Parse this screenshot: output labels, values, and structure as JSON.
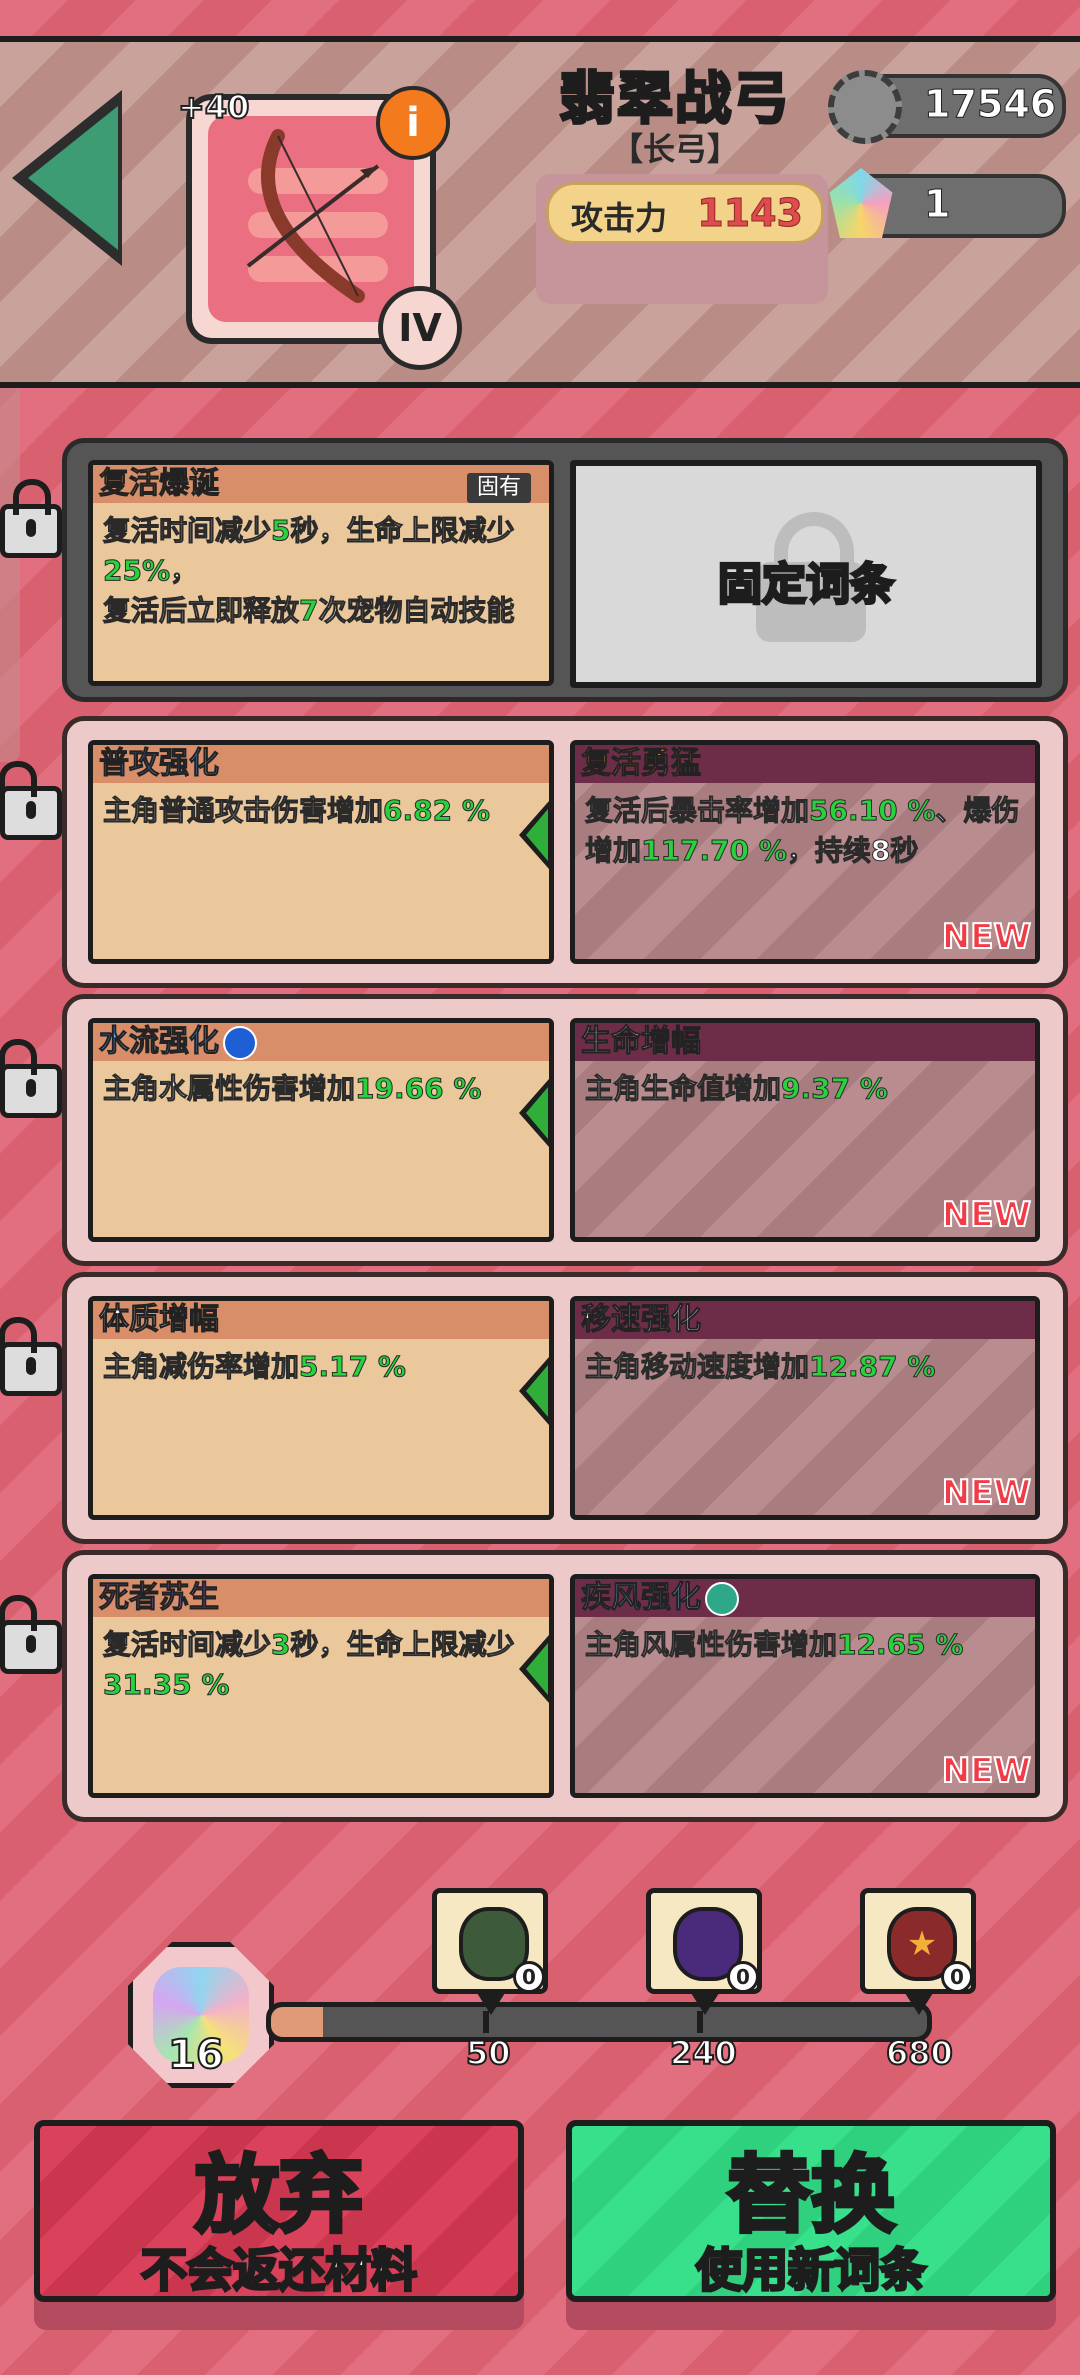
{
  "header": {
    "item_level": "+40",
    "info_icon": "i",
    "tier": "IV",
    "title": "翡翠战弓",
    "subtitle": "【长弓】",
    "attack_label": "攻击力",
    "attack_value": "1143",
    "gear_value": "17546",
    "crystal_value": "1"
  },
  "affix_rows": [
    {
      "locked": true,
      "old": {
        "name": "复活爆诞",
        "badge": "固有",
        "text_parts": [
          "复活时间减少",
          "5",
          "秒，生命上限减少",
          "25%",
          "，",
          "复活后立即释放",
          "7",
          "次宠物自动技能"
        ]
      },
      "fixed_label": "固定词条"
    },
    {
      "locked": false,
      "old": {
        "name": "普攻强化",
        "pre": "主角普通攻击伤害增加",
        "value": "6.82 %"
      },
      "new": {
        "name": "复活勇猛",
        "pre": "复活后暴击率增加",
        "value": "56.10 %",
        "mid": "、爆伤增加",
        "value2": "117.70 %",
        "post": "，持续8秒"
      },
      "new_tag": "NEW"
    },
    {
      "locked": false,
      "old": {
        "name": "水流强化",
        "pre": "主角水属性伤害增加",
        "value": "19.66 %"
      },
      "new": {
        "name": "生命增幅",
        "pre": "主角生命值增加",
        "value": "9.37 %"
      },
      "new_tag": "NEW"
    },
    {
      "locked": false,
      "old": {
        "name": "体质增幅",
        "pre": "主角减伤率增加",
        "value": "5.17 %"
      },
      "new": {
        "name": "移速强化",
        "pre": "主角移动速度增加",
        "value": "12.87 %"
      },
      "new_tag": "NEW"
    },
    {
      "locked": false,
      "old": {
        "name": "死者苏生",
        "pre": "复活时间减少",
        "v1": "3",
        "mid": "秒，生命上限减少",
        "value": "31.35 %"
      },
      "new": {
        "name": "疾风强化",
        "pre": "主角风属性伤害增加",
        "value": "12.65 %"
      },
      "new_tag": "NEW"
    }
  ],
  "materials": {
    "bag_count": "16",
    "progress_fraction": 0.08,
    "rewards": [
      {
        "threshold": "50",
        "count": "0",
        "color": "#3d5a3a"
      },
      {
        "threshold": "240",
        "count": "0",
        "color": "#4a2a7a"
      },
      {
        "threshold": "680",
        "count": "0",
        "color": "#8a2a2a"
      }
    ]
  },
  "buttons": {
    "abandon_main": "放弃",
    "abandon_sub": "不会返还材料",
    "replace_main": "替换",
    "replace_sub": "使用新词条"
  },
  "colors": {
    "highlight_value": "#27d23c",
    "new_tag": "#f13b46",
    "replace_button": "#38e08c",
    "abandon_button": "#d9425a"
  }
}
